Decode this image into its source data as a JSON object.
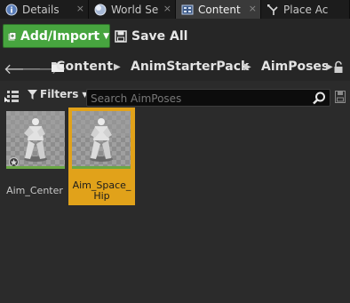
{
  "tabs": [
    {
      "label": "Details",
      "icon": "details-icon"
    },
    {
      "label": "World Se",
      "icon": "globe-icon"
    },
    {
      "label": "Content",
      "icon": "content-browser-icon",
      "active": true
    },
    {
      "label": "Place Ac",
      "icon": "place-actors-icon"
    }
  ],
  "tab_close_glyph": "×",
  "toolbar": {
    "add_import_label": "Add/Import",
    "save_all_label": "Save All"
  },
  "path": {
    "back_glyph": "🡐",
    "forward_glyph": "🡒",
    "crumbs": [
      "Content",
      "AnimStarterPack",
      "AimPoses"
    ]
  },
  "filters": {
    "label": "Filters",
    "search_placeholder": "Search AimPoses"
  },
  "assets": [
    {
      "name": "Aim_Center",
      "selected": false
    },
    {
      "name": "Aim_Space_\nHip",
      "selected": true
    }
  ],
  "colors": {
    "accent_green": "#47a53f",
    "selection_orange": "#e1a21a",
    "background": "#2b2b2b"
  }
}
